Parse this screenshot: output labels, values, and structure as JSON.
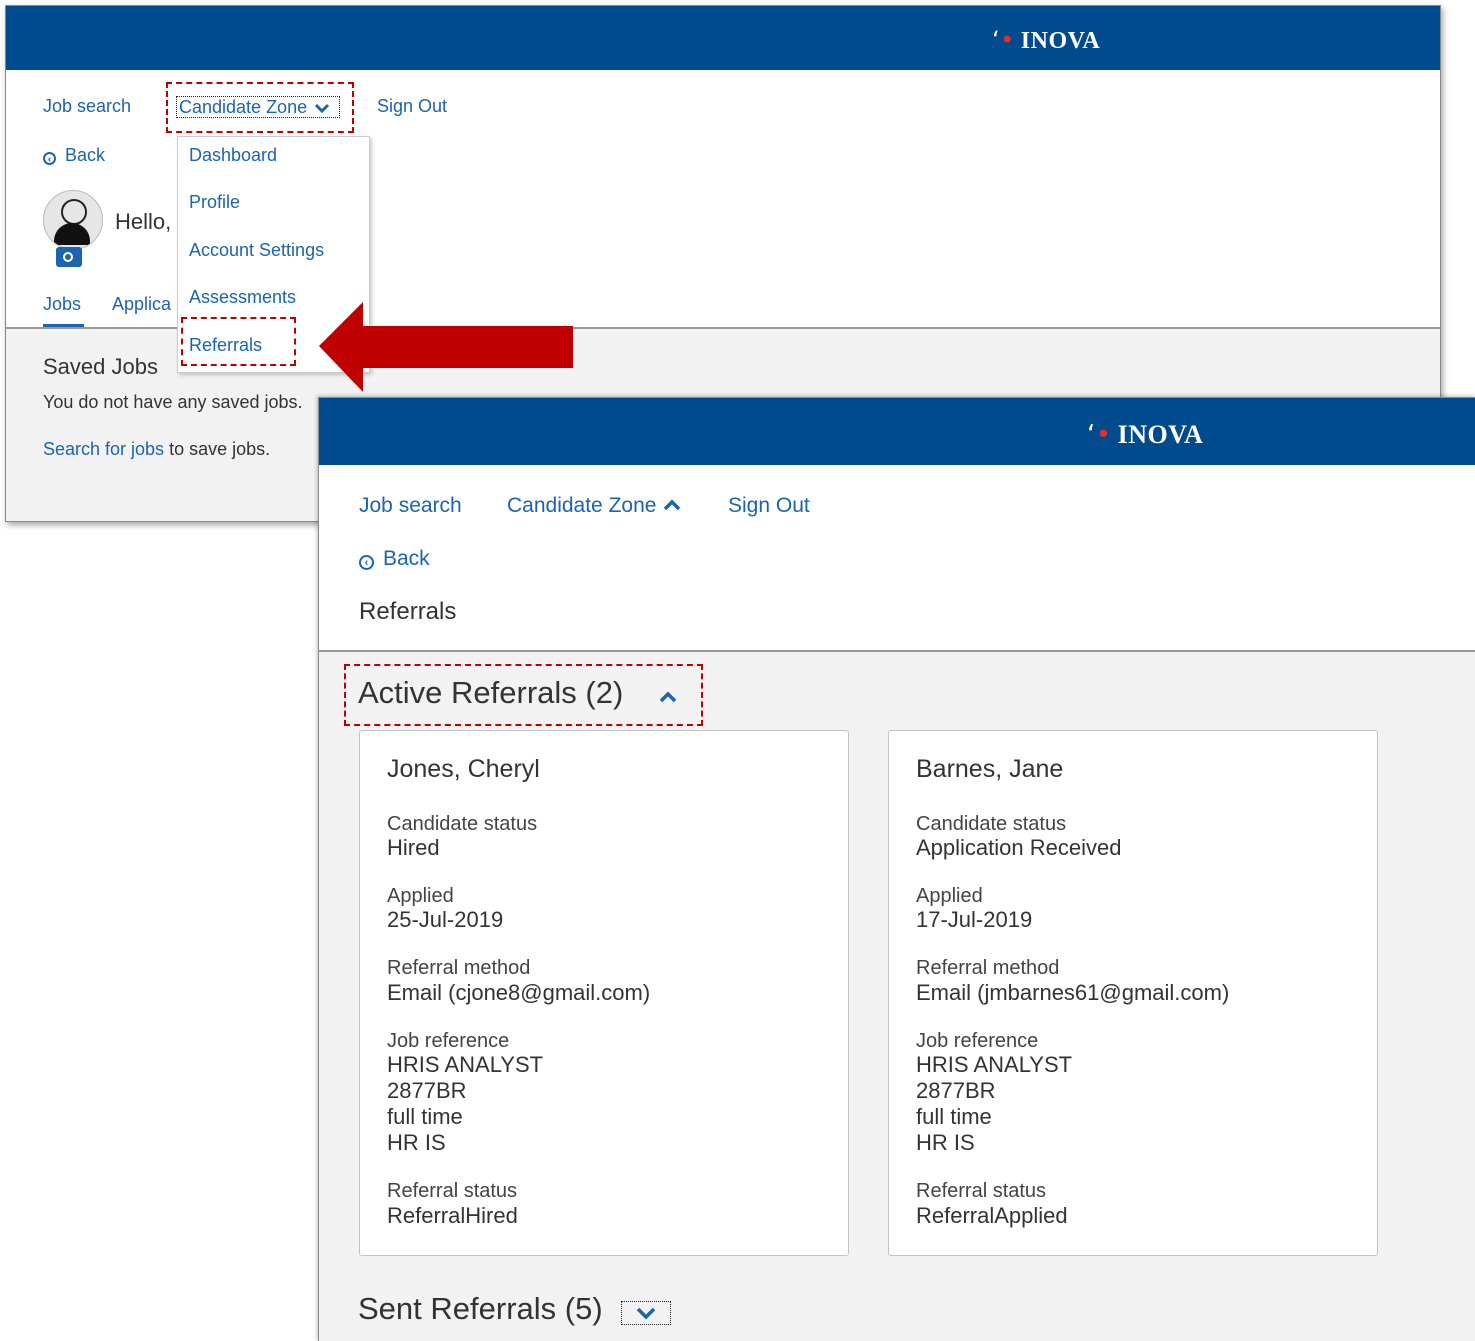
{
  "brand": {
    "name": "INOVA",
    "banner_color": "#004b8d",
    "accent_red": "#c00000",
    "link_color": "#1a64b0"
  },
  "window1": {
    "nav": {
      "job_search": "Job search",
      "candidate_zone": "Candidate Zone",
      "sign_out": "Sign Out"
    },
    "back": "Back",
    "greeting": "Hello,",
    "tabs": {
      "jobs": "Jobs",
      "applications": "Applica"
    },
    "dropdown": {
      "items": [
        "Dashboard",
        "Profile",
        "Account Settings",
        "Assessments",
        "Referrals"
      ]
    },
    "saved_jobs": {
      "title": "Saved Jobs",
      "message": "You do not have any saved jobs.",
      "search_link": "Search for jobs",
      "search_suffix": " to save jobs."
    }
  },
  "window2": {
    "nav": {
      "job_search": "Job search",
      "candidate_zone": "Candidate Zone",
      "sign_out": "Sign Out"
    },
    "back": "Back",
    "page_title": "Referrals",
    "active_section": "Active Referrals (2)",
    "sent_section": "Sent Referrals (5)",
    "labels": {
      "candidate_status": "Candidate status",
      "applied": "Applied",
      "referral_method": "Referral method",
      "job_reference": "Job reference",
      "referral_status": "Referral status"
    },
    "cards": [
      {
        "name": "Jones, Cheryl",
        "candidate_status": "Hired",
        "applied": "25-Jul-2019",
        "referral_method": "Email (cjone8@gmail.com)",
        "job_reference": [
          "HRIS ANALYST",
          "2877BR",
          "full time",
          "HR IS"
        ],
        "referral_status": "ReferralHired"
      },
      {
        "name": "Barnes, Jane",
        "candidate_status": "Application Received",
        "applied": "17-Jul-2019",
        "referral_method": "Email (jmbarnes61@gmail.com)",
        "job_reference": [
          "HRIS ANALYST",
          "2877BR",
          "full time",
          "HR IS"
        ],
        "referral_status": "ReferralApplied"
      }
    ]
  }
}
